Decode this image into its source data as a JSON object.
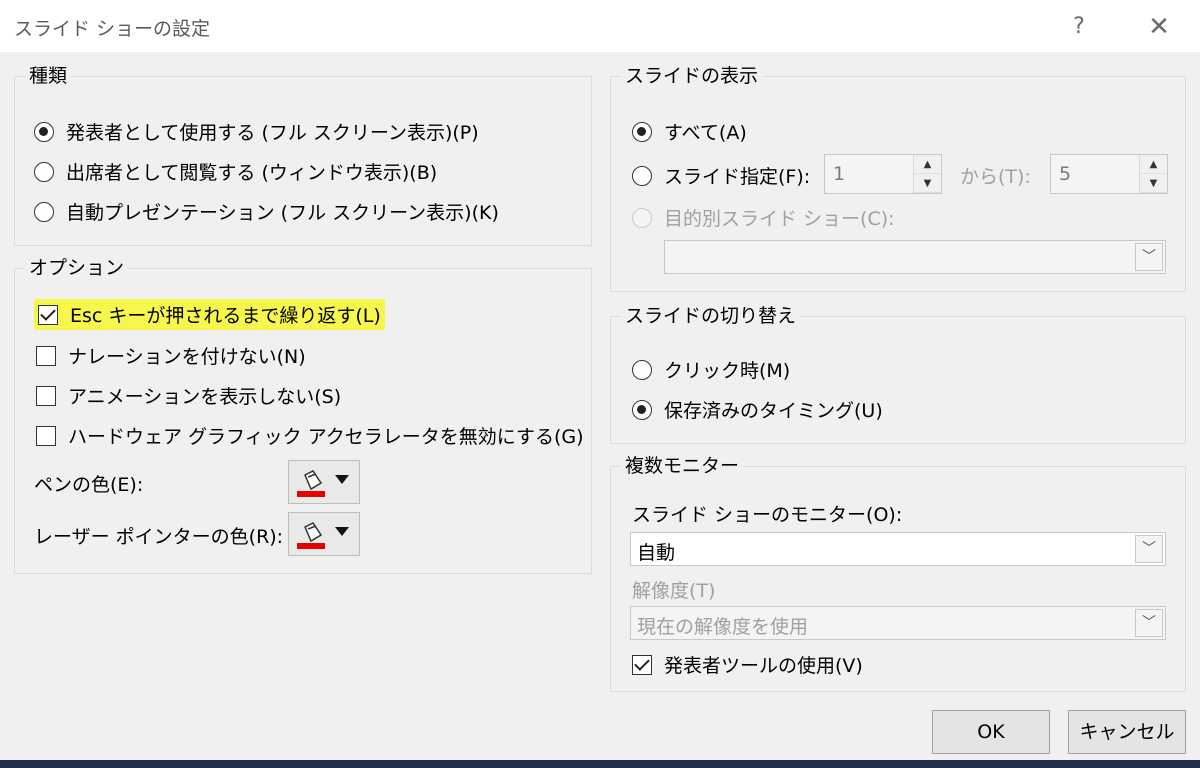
{
  "window": {
    "title": "スライド ショーの設定",
    "help_label": "?",
    "close_label": "✕"
  },
  "type_group": {
    "title": "種類",
    "options": [
      {
        "label": "発表者として使用する (フル スクリーン表示)(P)",
        "checked": true
      },
      {
        "label": "出席者として閲覧する (ウィンドウ表示)(B)",
        "checked": false
      },
      {
        "label": "自動プレゼンテーション (フル スクリーン表示)(K)",
        "checked": false
      }
    ]
  },
  "options_group": {
    "title": "オプション",
    "checkboxes": [
      {
        "label": "Esc キーが押されるまで繰り返す(L)",
        "checked": true
      },
      {
        "label": "ナレーションを付けない(N)",
        "checked": false
      },
      {
        "label": "アニメーションを表示しない(S)",
        "checked": false
      },
      {
        "label": "ハードウェア グラフィック アクセラレータを無効にする(G)",
        "checked": false
      }
    ],
    "pen_color_label": "ペンの色(E):",
    "laser_color_label": "レーザー ポインターの色(R):",
    "color_accent": "#e60000"
  },
  "slides_group": {
    "title": "スライドの表示",
    "all_label": "すべて(A)",
    "range_label": "スライド指定(F):",
    "from_value": "1",
    "to_label": "から(T):",
    "to_value": "5",
    "custom_label": "目的別スライド ショー(C):",
    "custom_value": ""
  },
  "advance_group": {
    "title": "スライドの切り替え",
    "manual_label": "クリック時(M)",
    "timings_label": "保存済みのタイミング(U)"
  },
  "monitors_group": {
    "title": "複数モニター",
    "monitor_label": "スライド ショーのモニター(O):",
    "monitor_value": "自動",
    "resolution_label": "解像度(T)",
    "resolution_value": "現在の解像度を使用",
    "presenter_view_label": "発表者ツールの使用(V)"
  },
  "buttons": {
    "ok": "OK",
    "cancel": "キャンセル"
  }
}
